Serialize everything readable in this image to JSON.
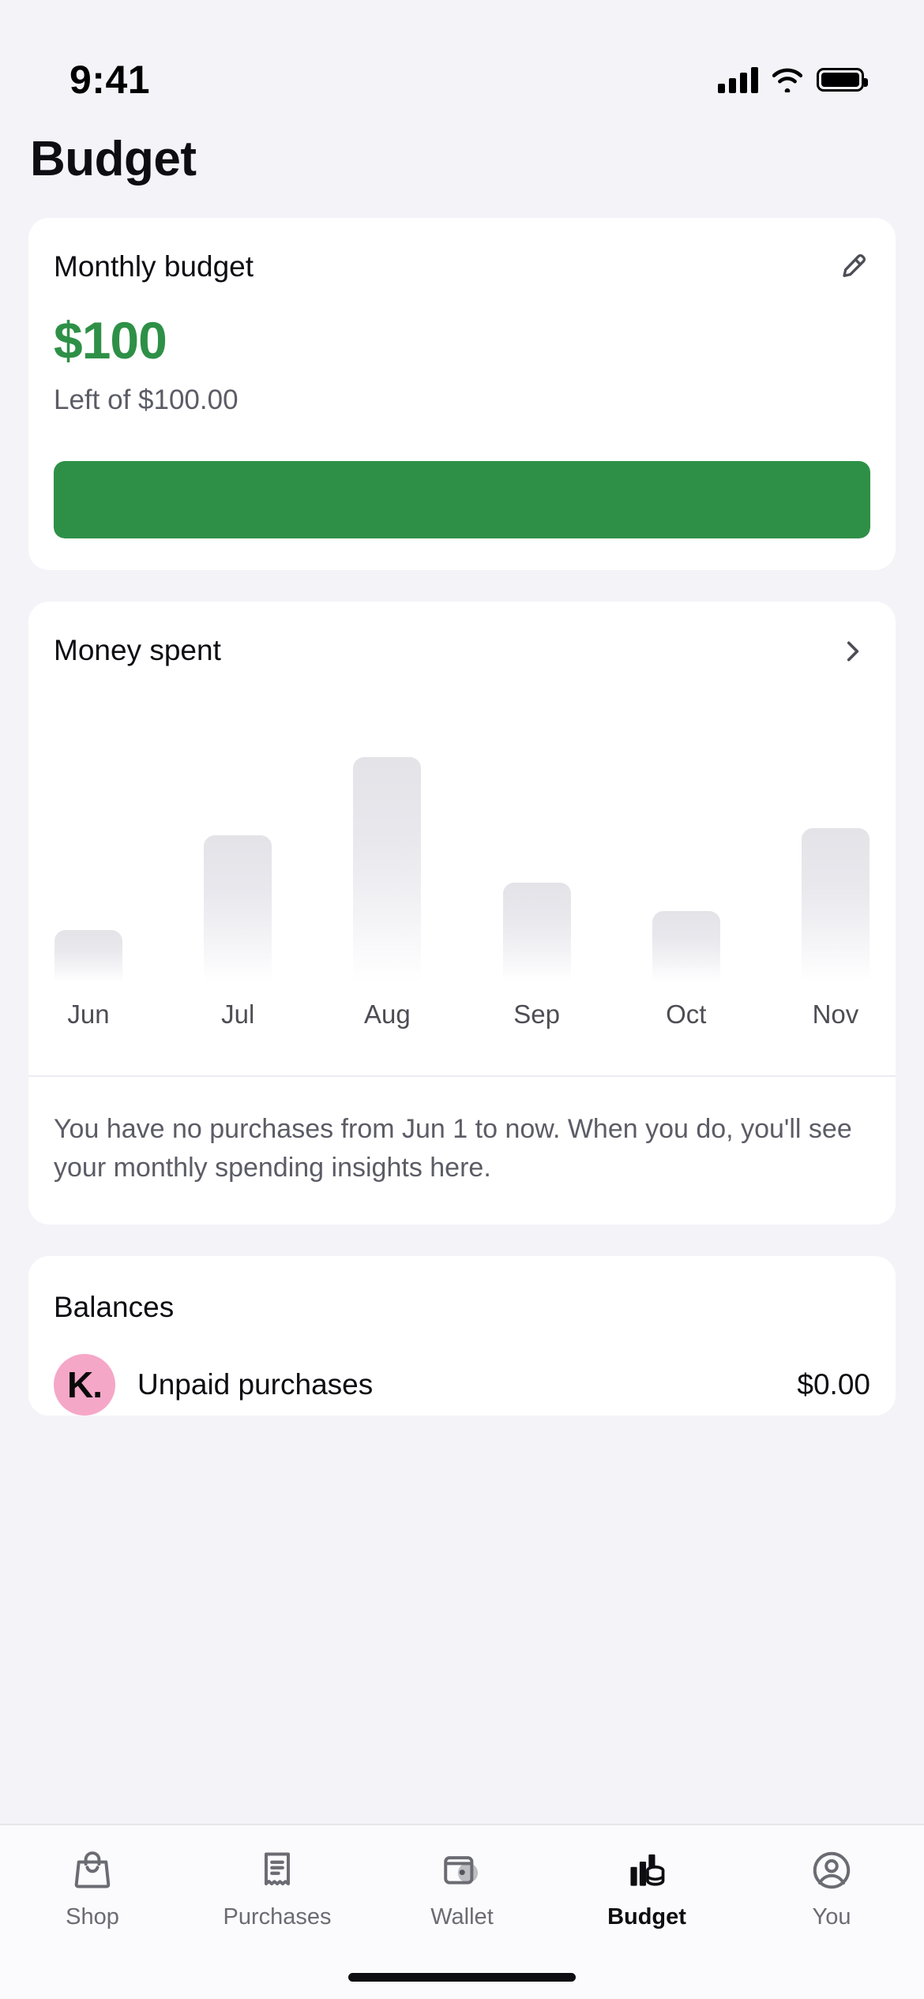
{
  "status_bar": {
    "time": "9:41",
    "cellular_icon": "cellular-signal-icon",
    "wifi_icon": "wifi-icon",
    "battery_icon": "battery-full-icon"
  },
  "header": {
    "title": "Budget"
  },
  "budget_card": {
    "title": "Monthly budget",
    "edit_icon": "pencil-icon",
    "amount": "$100",
    "subtitle": "Left of $100.00",
    "amount_color": "#2E9047",
    "progress_color": "#2E9047",
    "progress_track_color": "#ECECEF",
    "progress_percent": 100
  },
  "money_spent_card": {
    "title": "Money spent",
    "chevron_icon": "chevron-right-icon",
    "empty_message": "You have no purchases from Jun 1 to now. When you do, you'll see your monthly spending insights here."
  },
  "chart_data": {
    "type": "bar",
    "title": "Money spent",
    "categories": [
      "Jun",
      "Jul",
      "Aug",
      "Sep",
      "Oct",
      "Nov"
    ],
    "values": [
      22,
      62,
      95,
      42,
      30,
      65
    ],
    "ylim": [
      0,
      100
    ],
    "xlabel": "",
    "ylabel": "",
    "grid": false,
    "legend": false,
    "placeholder_state": true,
    "bar_fill_top_color": "#E3E3E8",
    "bar_fill_bottom_color": "#FFFFFF"
  },
  "balances_card": {
    "title": "Balances",
    "rows": [
      {
        "avatar_icon": "klarna-logo-icon",
        "avatar_text": "K.",
        "avatar_color": "#F5A7C8",
        "label": "Unpaid purchases",
        "value": "$0.00"
      }
    ]
  },
  "tab_bar": {
    "tabs": [
      {
        "label": "Shop",
        "icon": "shopping-bag-icon",
        "active": false
      },
      {
        "label": "Purchases",
        "icon": "receipt-icon",
        "active": false
      },
      {
        "label": "Wallet",
        "icon": "wallet-icon",
        "active": false
      },
      {
        "label": "Budget",
        "icon": "bar-chart-coins-icon",
        "active": true
      },
      {
        "label": "You",
        "icon": "person-circle-icon",
        "active": false
      }
    ]
  }
}
